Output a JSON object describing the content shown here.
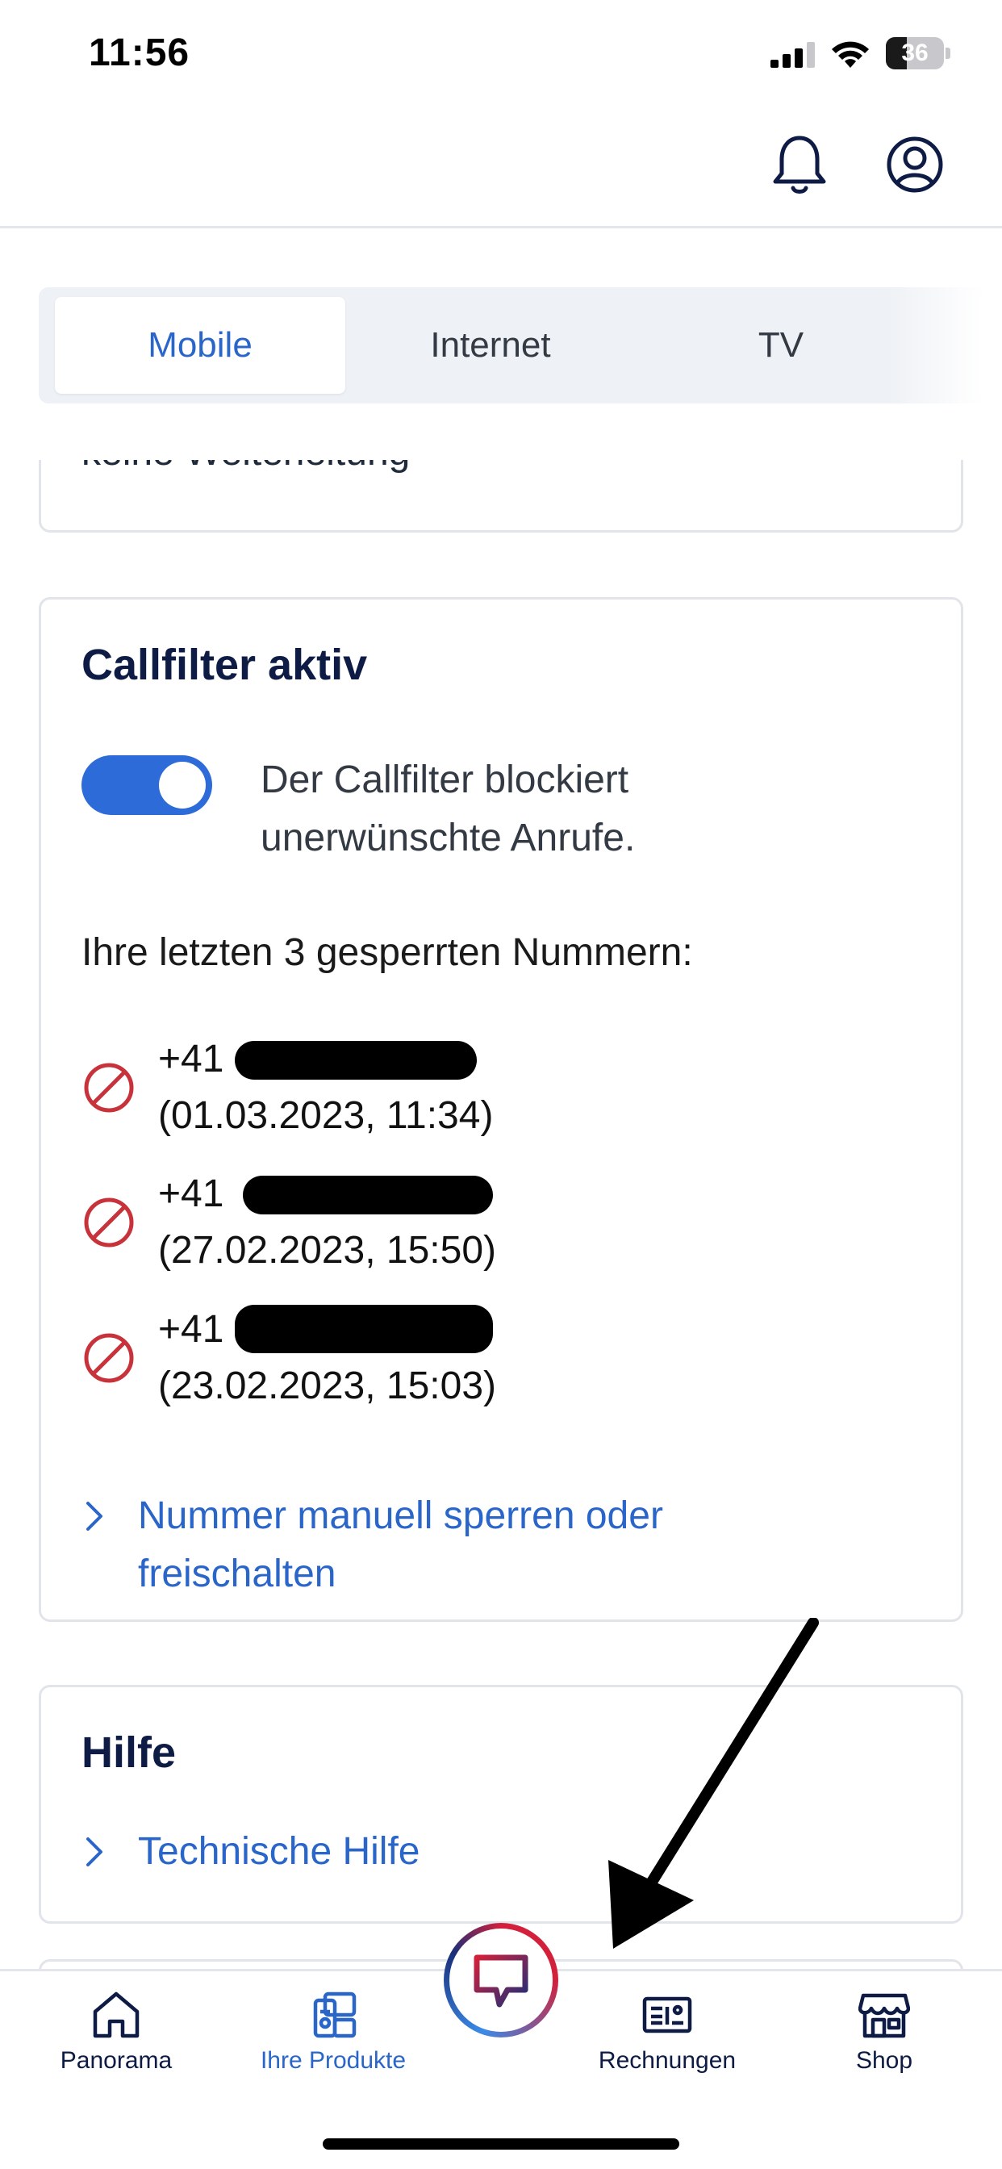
{
  "status_bar": {
    "time": "11:56",
    "battery_level": "36"
  },
  "tabs": [
    {
      "label": "Mobile",
      "active": true
    },
    {
      "label": "Internet",
      "active": false
    },
    {
      "label": "TV",
      "active": false
    }
  ],
  "previous_card": {
    "text": "keine Weiterleitung"
  },
  "callfilter": {
    "title": "Callfilter aktiv",
    "toggle_on": true,
    "description": "Der Callfilter blockiert unerwünschte Anrufe.",
    "list_heading": "Ihre letzten 3 gesperrten Nummern:",
    "blocked_numbers": [
      {
        "prefix": "+41",
        "date": "(01.03.2023, 11:34)"
      },
      {
        "prefix": "+41",
        "date": "(27.02.2023, 15:50)"
      },
      {
        "prefix": "+41",
        "date": "(23.02.2023, 15:03)"
      }
    ],
    "manual_link": "Nummer manuell sperren oder freischalten"
  },
  "help": {
    "title": "Hilfe",
    "link": "Technische Hilfe"
  },
  "bottom_nav": [
    {
      "label": "Panorama",
      "icon": "home-icon"
    },
    {
      "label": "Ihre Produkte",
      "icon": "products-icon",
      "active": true
    },
    {
      "label": "Rechnungen",
      "icon": "invoice-icon"
    },
    {
      "label": "Shop",
      "icon": "shop-icon"
    }
  ],
  "colors": {
    "accent": "#2a66c9",
    "toggle": "#2d6bd8",
    "title": "#0d1b45",
    "blocked_icon": "#c8323a"
  }
}
